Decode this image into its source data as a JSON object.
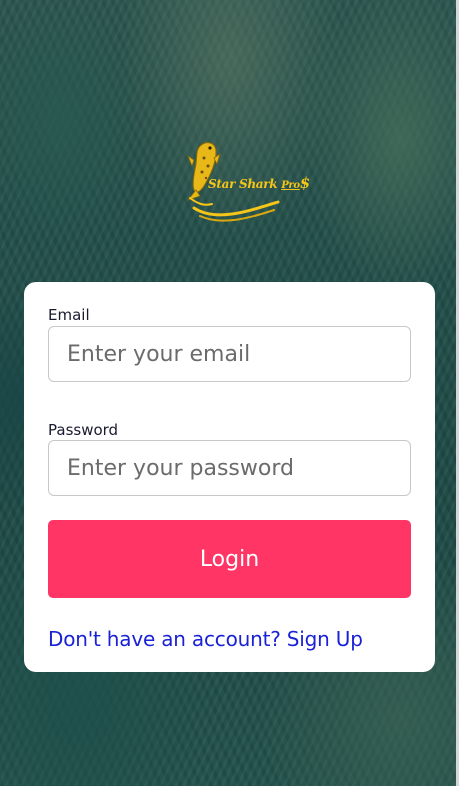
{
  "brand": {
    "logo_name": "Star Shark",
    "logo_suffix": "Pro",
    "logo_symbol": "$",
    "logo_color": "#f5c518"
  },
  "form": {
    "email_label": "Email",
    "email_placeholder": "Enter your email",
    "email_value": "",
    "password_label": "Password",
    "password_placeholder": "Enter your password",
    "password_value": "",
    "login_label": "Login",
    "signup_link": "Don't have an account? Sign Up"
  },
  "colors": {
    "primary_button": "#ff3566",
    "link": "#1a22d6",
    "card_background": "#ffffff"
  }
}
